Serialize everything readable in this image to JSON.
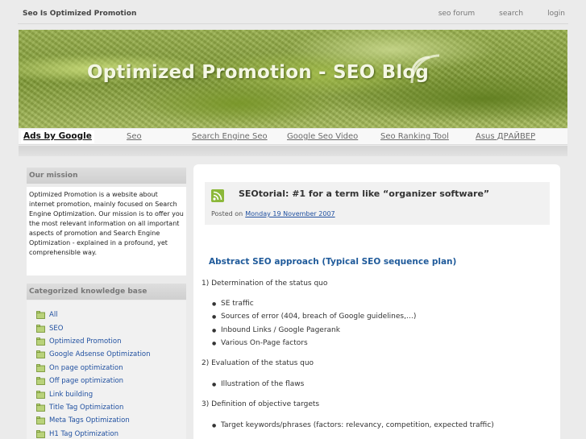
{
  "topbar": {
    "site_name": "Seo Is Optimized Promotion",
    "links": [
      "seo forum",
      "search",
      "login"
    ]
  },
  "banner": {
    "title": "Optimized Promotion - SEO Blog"
  },
  "ads": {
    "label": "Ads by Google",
    "links": [
      "Seo",
      "Search Engine Seo",
      "Google Seo Video",
      "Seo Ranking Tool",
      "Asus ДРАЙВЕР"
    ]
  },
  "sidebar": {
    "mission_heading": "Our mission",
    "mission_text": "Optimized Promotion is a website about internet promotion, mainly focused on Search Engine Optimization. Our mission is to offer you the most relevant information on all important aspects of promotion and Search Engine Optimization - explained in a profound, yet comprehensible way.",
    "kb_heading": "Categorized knowledge base",
    "kb_items": [
      "All",
      "SEO",
      "Optimized Promotion",
      "Google Adsense Optimization",
      "On page optimization",
      "Off page optimization",
      "Link building",
      "Title Tag Optimization",
      "Meta Tags Optimization",
      "H1 Tag Optimization"
    ]
  },
  "post": {
    "title": "SEOtorial: #1 for a term like “organizer software”",
    "posted_on": "Posted on",
    "date": "Monday 19 November 2007"
  },
  "article": {
    "heading": "Abstract SEO approach (Typical SEO sequence plan)",
    "step1": "1) Determination of the status quo",
    "step1_items": [
      "SE traffic",
      "Sources of error (404, breach of Google guidelines,…)",
      "Inbound Links / Google Pagerank",
      "Various On-Page factors"
    ],
    "step2": "2) Evaluation of the status quo",
    "step2_items": [
      "Illustration of the flaws"
    ],
    "step3": "3) Definition of objective targets",
    "step3_items": [
      "Target keywords/phrases (factors: relevancy, competition, expected traffic)"
    ]
  },
  "colors": {
    "link": "#2050a0",
    "heading_blue": "#1f5a9a",
    "banner_green": "#8ca846"
  }
}
